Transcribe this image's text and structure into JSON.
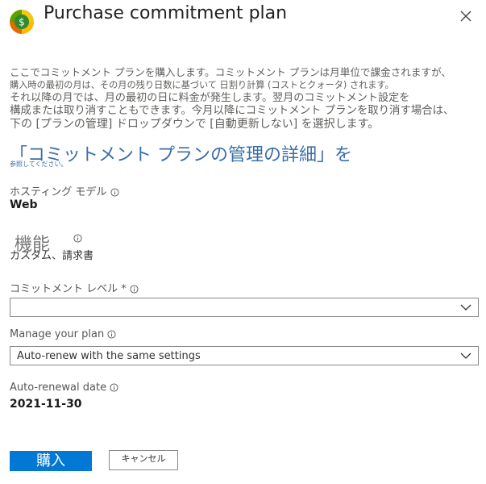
{
  "panel": {
    "title": "Purchase commitment plan",
    "close_icon": "close-icon",
    "app_icon": "cognitive-services-icon"
  },
  "description": {
    "lines": [
      "ここでコミットメント プランを購入します。コミットメント プランは月単位で課金されますが、",
      "購入時の最初の月は、その月の残り日数に基づいて 日割り計算 (コストとクォータ) されます。",
      "それ以降の月では、月の最初の日に料金が発生します。翌月のコミットメント設定を",
      "構成または取り消すこともできます。今月以降にコミットメント プランを取り消す場合は、",
      "下の [プランの管理] ドロップダウンで [自動更新しない] を選択します。"
    ],
    "link_text": "「コミットメント プランの管理の詳細」を",
    "link_sub": "参照してください。"
  },
  "hosting_model": {
    "label": "ホスティング モデル",
    "value": "Web"
  },
  "features": {
    "label": "機能",
    "value": "カスタム、請求書"
  },
  "commitment_level": {
    "label": "コミットメント レベル *",
    "value": ""
  },
  "manage_plan": {
    "label": "Manage your plan",
    "value": "Auto-renew with the same settings"
  },
  "renewal": {
    "label": "Auto-renewal date",
    "value": "2021-11-30"
  },
  "actions": {
    "purchase": "購入",
    "cancel": "キャンセル"
  },
  "colors": {
    "primary": "#0078d4",
    "link": "#3a6ea8"
  }
}
